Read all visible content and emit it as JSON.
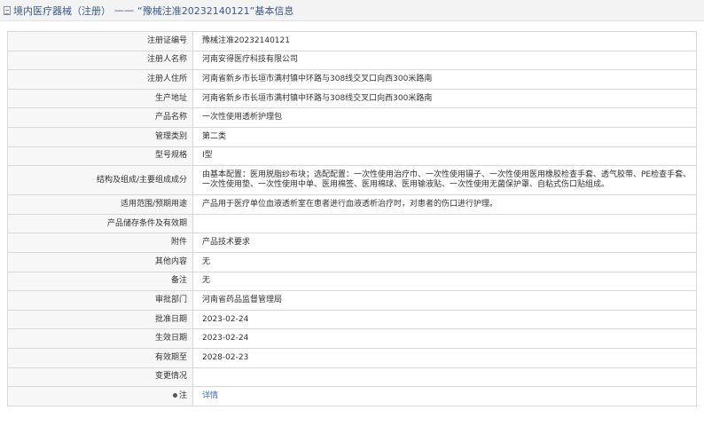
{
  "header": {
    "breadcrumb": "境内医疗器械（注册）",
    "separator": "——",
    "title": "“豫械注准20232140121”基本信息"
  },
  "rows": [
    {
      "label": "注册证编号",
      "value": "豫械注准20232140121"
    },
    {
      "label": "注册人名称",
      "value": "河南安得医疗科技有限公司"
    },
    {
      "label": "注册人住所",
      "value": "河南省新乡市长垣市满村镇中环路与308线交叉口向西300米路南"
    },
    {
      "label": "生产地址",
      "value": "河南省新乡市长垣市满村镇中环路与308线交叉口向西300米路南"
    },
    {
      "label": "产品名称",
      "value": "一次性使用透析护理包"
    },
    {
      "label": "管理类别",
      "value": "第二类"
    },
    {
      "label": "型号规格",
      "value": "Ⅰ型"
    },
    {
      "label": "结构及组成/主要组成成分",
      "value": "由基本配置：医用脱脂纱布块；选配配置：一次性使用治疗巾、一次性使用镊子、一次性使用医用橡胶检查手套、透气胶带、PE检查手套、一次性使用垫、一次性使用中单、医用棉签、医用棉球、医用输液贴、一次性使用无菌保护罩、自粘式伤口贴组成。"
    },
    {
      "label": "适用范围/预期用途",
      "value": "产品用于医疗单位血液透析室在患者进行血液透析治疗时，对患者的伤口进行护理。"
    },
    {
      "label": "产品储存条件及有效期",
      "value": ""
    },
    {
      "label": "附件",
      "value": "产品技术要求"
    },
    {
      "label": "其他内容",
      "value": "无"
    },
    {
      "label": "备注",
      "value": "无"
    },
    {
      "label": "审批部门",
      "value": "河南省药品监督管理局"
    },
    {
      "label": "批准日期",
      "value": "2023-02-24"
    },
    {
      "label": "生效日期",
      "value": "2023-02-24"
    },
    {
      "label": "有效期至",
      "value": "2028-02-23"
    },
    {
      "label": "变更情况",
      "value": ""
    }
  ],
  "note_row": {
    "label": "注",
    "value": "详情"
  }
}
